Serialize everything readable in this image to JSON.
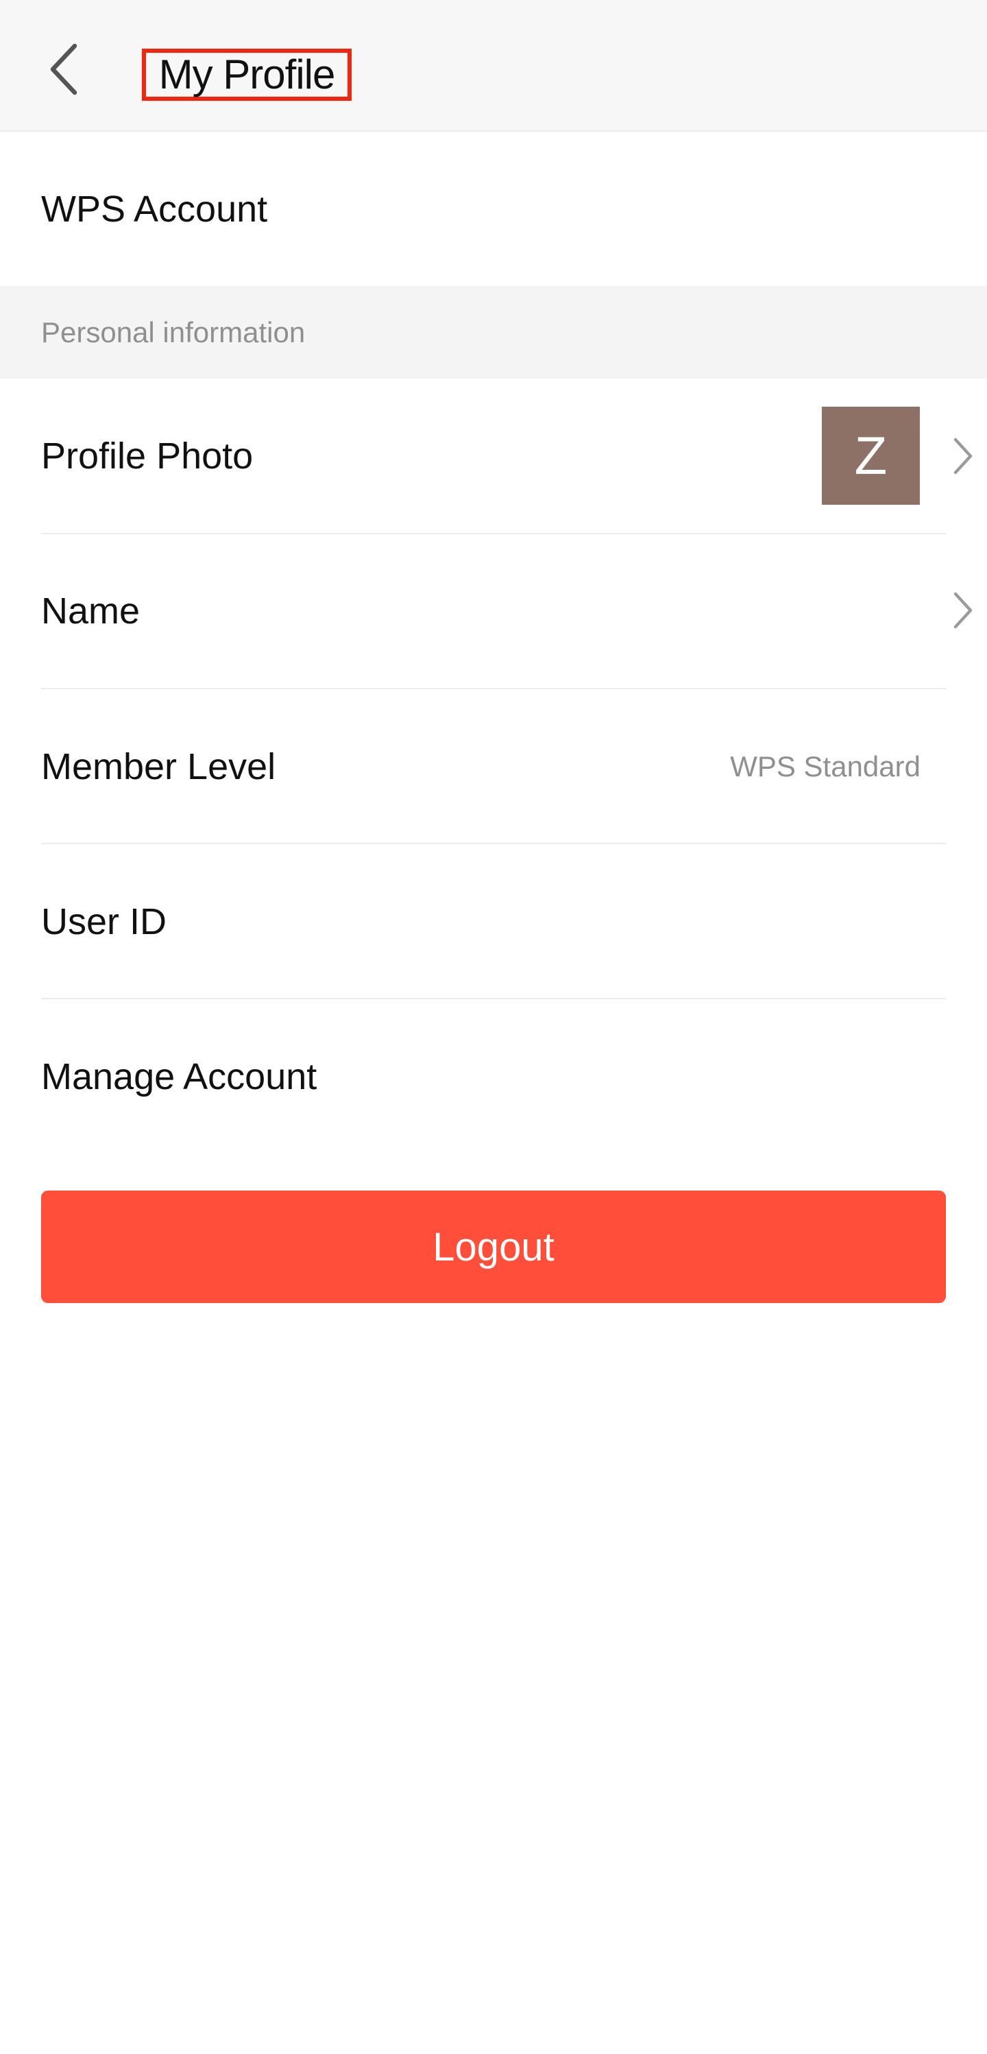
{
  "header": {
    "title": "My Profile",
    "back_icon": "chevron-left-icon"
  },
  "account": {
    "label": "WPS Account"
  },
  "section": {
    "label": "Personal information"
  },
  "rows": {
    "profile_photo": {
      "label": "Profile Photo",
      "avatar_letter": "Z",
      "chevron_icon": "chevron-right-icon"
    },
    "name": {
      "label": "Name",
      "chevron_icon": "chevron-right-icon"
    },
    "member_level": {
      "label": "Member Level",
      "value": "WPS Standard"
    },
    "user_id": {
      "label": "User ID"
    },
    "manage_account": {
      "label": "Manage Account"
    }
  },
  "logout": {
    "label": "Logout"
  },
  "colors": {
    "accent": "#ff4f3b",
    "title_highlight": "#f2250f",
    "avatar_bg": "#8d7166",
    "secondary_text": "#8f8f8f",
    "header_bg": "#f7f7f7"
  }
}
